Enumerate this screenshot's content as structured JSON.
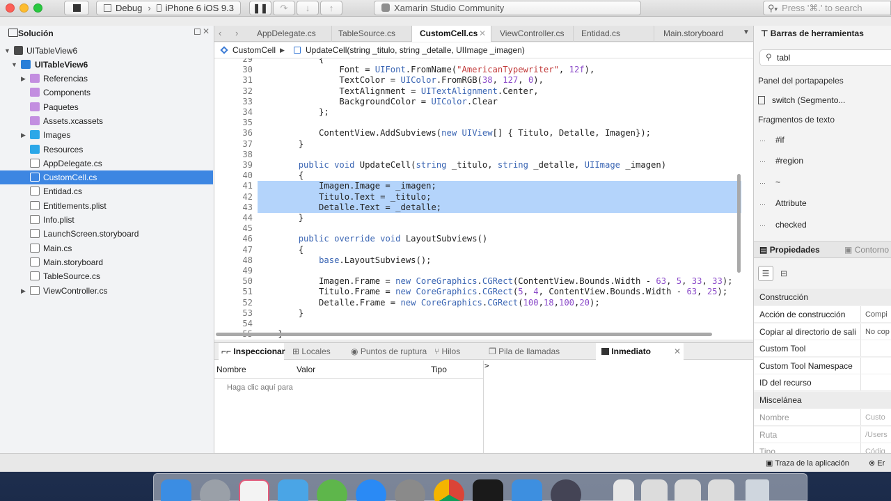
{
  "titlebar": {
    "config": "Debug",
    "device": "iPhone 6 iOS 9.3",
    "app_title": "Xamarin Studio Community",
    "search_placeholder": "Press '⌘.' to search"
  },
  "solution": {
    "header": "Solución",
    "root": "UITableView6",
    "project": "UITableView6",
    "items": [
      {
        "label": "Referencias",
        "icon": "folder-icon"
      },
      {
        "label": "Components",
        "icon": "folder-icon"
      },
      {
        "label": "Paquetes",
        "icon": "folder-icon"
      },
      {
        "label": "Assets.xcassets",
        "icon": "folder-icon"
      },
      {
        "label": "Images",
        "icon": "folder-icon"
      },
      {
        "label": "Resources",
        "icon": "folder-icon"
      },
      {
        "label": "AppDelegate.cs",
        "icon": "file-icon"
      },
      {
        "label": "CustomCell.cs",
        "icon": "file-icon"
      },
      {
        "label": "Entidad.cs",
        "icon": "file-icon"
      },
      {
        "label": "Entitlements.plist",
        "icon": "file-icon"
      },
      {
        "label": "Info.plist",
        "icon": "file-icon"
      },
      {
        "label": "LaunchScreen.storyboard",
        "icon": "file-icon"
      },
      {
        "label": "Main.cs",
        "icon": "file-icon"
      },
      {
        "label": "Main.storyboard",
        "icon": "file-icon"
      },
      {
        "label": "TableSource.cs",
        "icon": "file-icon"
      },
      {
        "label": "ViewController.cs",
        "icon": "file-icon"
      }
    ]
  },
  "tabs": [
    "AppDelegate.cs",
    "TableSource.cs",
    "CustomCell.cs",
    "ViewController.cs",
    "Entidad.cs",
    "Main.storyboard"
  ],
  "breadcrumb": {
    "class": "CustomCell",
    "method": "UpdateCell(string _titulo, string _detalle, UIImage _imagen)"
  },
  "code_lines": [
    {
      "n": "29",
      "t": "            {"
    },
    {
      "n": "30",
      "t": "                Font = UIFont.FromName(\"AmericanTypewriter\", 12f),"
    },
    {
      "n": "31",
      "t": "                TextColor = UIColor.FromRGB(38, 127, 0),"
    },
    {
      "n": "32",
      "t": "                TextAlignment = UITextAlignment.Center,"
    },
    {
      "n": "33",
      "t": "                BackgroundColor = UIColor.Clear"
    },
    {
      "n": "34",
      "t": "            };"
    },
    {
      "n": "35",
      "t": ""
    },
    {
      "n": "36",
      "t": "            ContentView.AddSubviews(new UIView[] { Titulo, Detalle, Imagen});"
    },
    {
      "n": "37",
      "t": "        }"
    },
    {
      "n": "38",
      "t": ""
    },
    {
      "n": "39",
      "t": "        public void UpdateCell(string _titulo, string _detalle, UIImage _imagen)"
    },
    {
      "n": "40",
      "t": "        {"
    },
    {
      "n": "41",
      "t": "            Imagen.Image = _imagen;"
    },
    {
      "n": "42",
      "t": "            Titulo.Text = _titulo;"
    },
    {
      "n": "43",
      "t": "            Detalle.Text = _detalle;"
    },
    {
      "n": "44",
      "t": "        }"
    },
    {
      "n": "45",
      "t": ""
    },
    {
      "n": "46",
      "t": "        public override void LayoutSubviews()"
    },
    {
      "n": "47",
      "t": "        {"
    },
    {
      "n": "48",
      "t": "            base.LayoutSubviews();"
    },
    {
      "n": "49",
      "t": ""
    },
    {
      "n": "50",
      "t": "            Imagen.Frame = new CoreGraphics.CGRect(ContentView.Bounds.Width - 63, 5, 33, 33);"
    },
    {
      "n": "51",
      "t": "            Titulo.Frame = new CoreGraphics.CGRect(5, 4, ContentView.Bounds.Width - 63, 25);"
    },
    {
      "n": "52",
      "t": "            Detalle.Frame = new CoreGraphics.CGRect(100,18,100,20);"
    },
    {
      "n": "53",
      "t": "        }"
    },
    {
      "n": "54",
      "t": ""
    },
    {
      "n": "55",
      "t": "    }"
    }
  ],
  "highlighted_lines": [
    "41",
    "42",
    "43"
  ],
  "pads": {
    "tabs": [
      "Inspeccionar",
      "Locales",
      "Puntos de ruptura",
      "Hilos",
      "Pila de llamadas",
      "Inmediato"
    ],
    "columns": [
      "Nombre",
      "Valor",
      "Tipo"
    ],
    "hint": "Haga clic aquí para",
    "prompt": ">"
  },
  "toolbox": {
    "header": "Barras de herramientas",
    "search_value": "tabl",
    "sections": [
      "Panel del portapapeles",
      "Fragmentos de texto"
    ],
    "clipboard_item": "switch (Segmento...",
    "snippets": [
      "#if",
      "#region",
      "~",
      "Attribute",
      "checked"
    ]
  },
  "properties": {
    "tab1": "Propiedades",
    "tab2": "Contorno",
    "section1": "Construcción",
    "rows": [
      {
        "label": "Acción de construcción",
        "value": "Compi"
      },
      {
        "label": "Copiar al directorio de sali",
        "value": "No cop"
      },
      {
        "label": "Custom Tool",
        "value": ""
      },
      {
        "label": "Custom Tool Namespace",
        "value": ""
      },
      {
        "label": "ID del recurso",
        "value": ""
      }
    ],
    "section2": "Miscelánea",
    "rows2": [
      {
        "label": "Nombre",
        "value": "Custo"
      },
      {
        "label": "Ruta",
        "value": "/Users"
      },
      {
        "label": "Tipo",
        "value": "Códig"
      }
    ]
  },
  "statusbar": {
    "trace": "Traza de la aplicación",
    "errors": "Er"
  },
  "colors": {
    "selection": "#3d86e2",
    "highlight": "#b4d4fb",
    "keyword": "#3a65b3",
    "string": "#c13a3a",
    "number": "#8b4bc9"
  }
}
